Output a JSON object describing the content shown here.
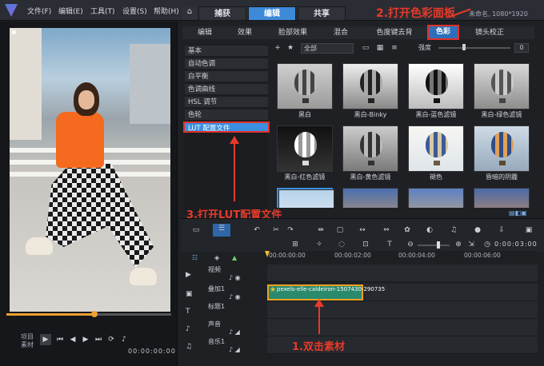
{
  "menu": [
    "文件(F)",
    "编辑(E)",
    "工具(T)",
    "设置(S)",
    "帮助(H)"
  ],
  "main_tabs": [
    {
      "label": "捕获"
    },
    {
      "label": "编辑"
    },
    {
      "label": "共享"
    }
  ],
  "project_info": "未命名, 1080*1920",
  "annotation_2": "2.打开色彩面板",
  "annotation_3": "3.打开LUT配置文件",
  "annotation_1": "1.双击素材",
  "preview_overlay": "项目 素材",
  "timecode": "00:00:00:00",
  "sub_tabs": [
    "编辑",
    "效果",
    "脸部效果",
    "混合",
    "色度键去背",
    "色彩",
    "镜头校正"
  ],
  "categories": [
    "基本",
    "自动色调",
    "白平衡",
    "色调曲线",
    "HSL 调节",
    "色轮",
    "LUT 配置文件"
  ],
  "filter_all": "全部",
  "strength_label": "强度",
  "strength_value": "0",
  "thumbnails": [
    {
      "label": "黑白"
    },
    {
      "label": "黑白-Binky"
    },
    {
      "label": "黑白-蓝色滤镜"
    },
    {
      "label": "黑白-绿色滤镜"
    },
    {
      "label": "黑白-红色滤镜"
    },
    {
      "label": "黑白-黄色滤镜"
    },
    {
      "label": "褪色"
    },
    {
      "label": "昏暗的阴霾"
    }
  ],
  "timeline_time": "0:00:03:00",
  "ruler": [
    "00:00:00:00",
    "00:00:02:00",
    "00:00:04:00",
    "00:00:06:00"
  ],
  "tracks": [
    {
      "name": "视频"
    },
    {
      "name": "叠加1"
    },
    {
      "name": "标题1"
    },
    {
      "name": "声音"
    },
    {
      "name": "音乐1"
    }
  ],
  "clip_name": "pexels-elle-caldeiron-1507430-290735"
}
